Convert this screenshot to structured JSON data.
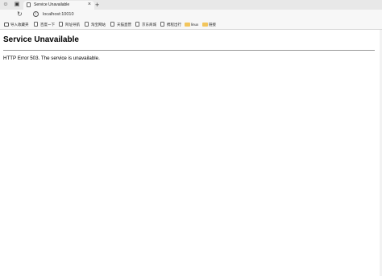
{
  "browser": {
    "tab": {
      "title": "Service Unavailable",
      "close": "×"
    },
    "new_tab": "+",
    "address_bar": {
      "url": "localhost:10010"
    },
    "bookmarks": [
      {
        "label": "导入收藏夹",
        "icon": "import-icon"
      },
      {
        "label": "百度一下",
        "icon": "page-icon"
      },
      {
        "label": "阿址导航",
        "icon": "page-icon"
      },
      {
        "label": "淘宝网站",
        "icon": "page-icon"
      },
      {
        "label": "天猫直营",
        "icon": "page-icon"
      },
      {
        "label": "京东商城",
        "icon": "page-icon"
      },
      {
        "label": "携程出行",
        "icon": "page-icon"
      },
      {
        "label": "linux",
        "icon": "folder-icon"
      },
      {
        "label": "链接",
        "icon": "folder-icon"
      }
    ]
  },
  "page": {
    "title": "Service Unavailable",
    "message": "HTTP Error 503. The service is unavailable."
  }
}
